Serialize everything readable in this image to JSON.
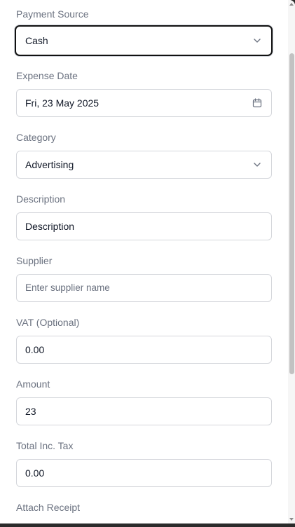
{
  "form": {
    "payment_source": {
      "label": "Payment Source",
      "value": "Cash",
      "icon": "chevron-down-icon"
    },
    "expense_date": {
      "label": "Expense Date",
      "value": "Fri, 23 May 2025",
      "icon": "calendar-icon"
    },
    "category": {
      "label": "Category",
      "value": "Advertising",
      "icon": "chevron-down-icon"
    },
    "description": {
      "label": "Description",
      "value": "Description"
    },
    "supplier": {
      "label": "Supplier",
      "placeholder": "Enter supplier name",
      "value": ""
    },
    "vat": {
      "label": "VAT (Optional)",
      "value": "0.00"
    },
    "amount": {
      "label": "Amount",
      "value": "23"
    },
    "total_inc_tax": {
      "label": "Total Inc. Tax",
      "value": "0.00"
    },
    "attach_receipt": {
      "label": "Attach Receipt"
    }
  },
  "colors": {
    "label_text": "#6b7280",
    "value_text": "#111827",
    "field_border": "#d4d6db",
    "focus_border": "#111111",
    "scrollbar_thumb": "#c2c2c2"
  }
}
